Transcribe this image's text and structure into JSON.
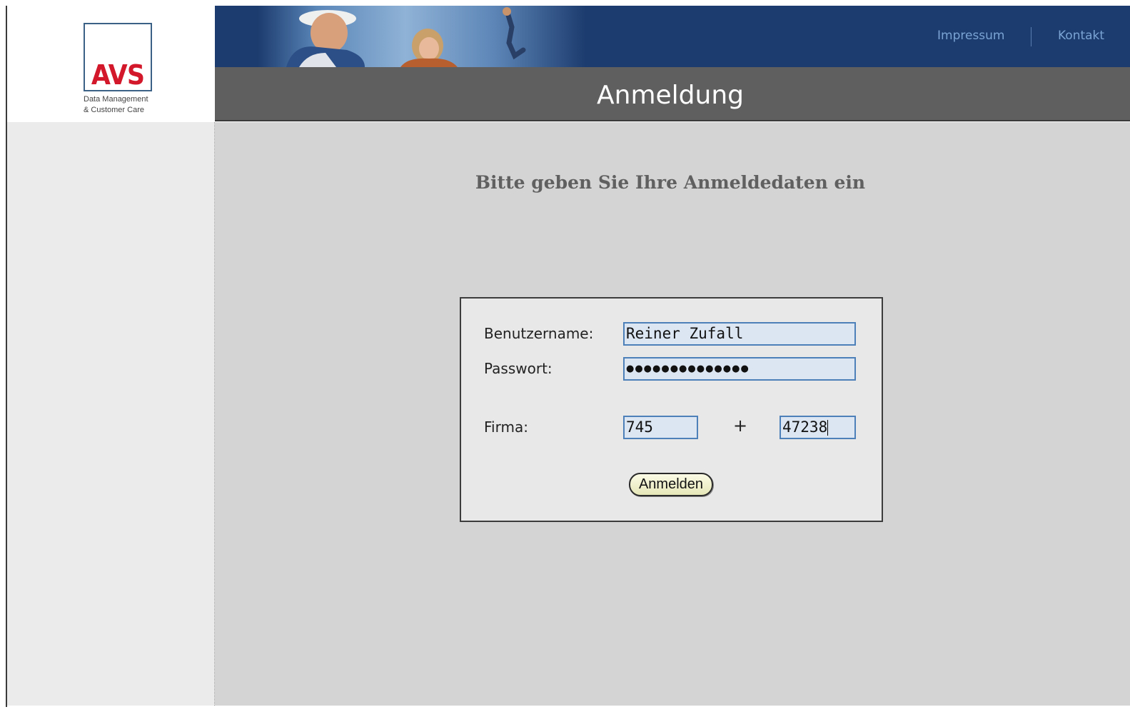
{
  "logo": {
    "brand": "AVS",
    "tagline_line1": "Data Management",
    "tagline_line2": "& Customer Care"
  },
  "header": {
    "links": [
      {
        "label": "Impressum"
      },
      {
        "label": "Kontakt"
      }
    ]
  },
  "page": {
    "title": "Anmeldung",
    "subtitle": "Bitte geben Sie Ihre Anmeldedaten ein"
  },
  "form": {
    "username_label": "Benutzername:",
    "username_value": "Reiner Zufall",
    "password_label": "Passwort:",
    "password_value": "●●●●●●●●●●●●●●",
    "company_label": "Firma:",
    "company_part1": "745",
    "plus_sign": "+",
    "company_part2": "47238",
    "submit_label": "Anmelden"
  },
  "colors": {
    "header_blue": "#1c3b6e",
    "title_bar": "#5f5f5f",
    "brand_red": "#d2182a",
    "input_bg": "#dce6f3",
    "input_border": "#4d7fb8"
  }
}
